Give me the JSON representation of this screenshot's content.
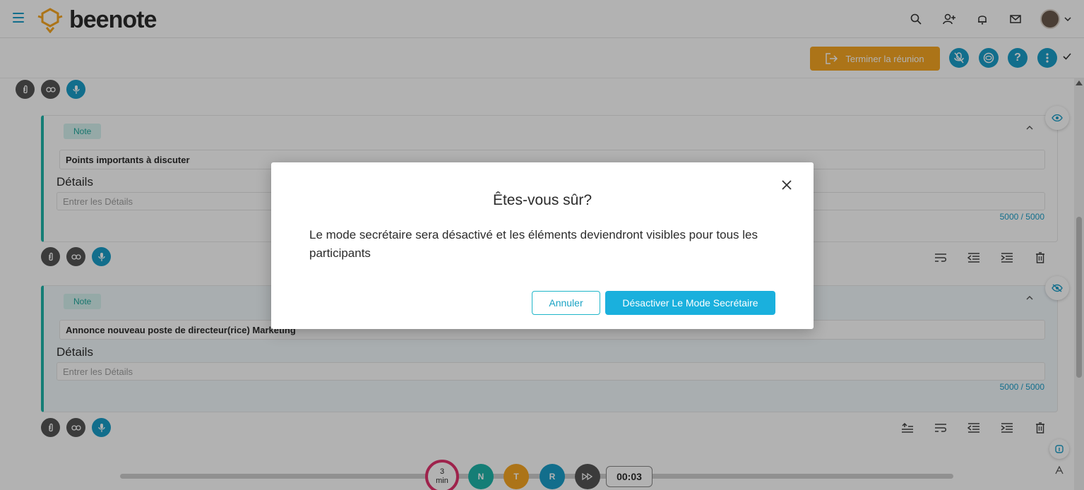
{
  "header": {
    "logo_text": "beenote"
  },
  "meeting_toolbar": {
    "end_meeting_label": "Terminer la réunion",
    "help_label": "?"
  },
  "notes": [
    {
      "badge": "Note",
      "title": "Points importants à discuter",
      "details_label": "Détails",
      "details_placeholder": "Entrer les Détails",
      "counter": "5000 / 5000"
    },
    {
      "badge": "Note",
      "title": "Annonce nouveau poste de directeur(rice) Marketing",
      "details_label": "Détails",
      "details_placeholder": "Entrer les Détails",
      "counter": "5000 / 5000"
    }
  ],
  "bottom": {
    "timer_value": "3",
    "timer_unit": "min",
    "btn_n": "N",
    "btn_t": "T",
    "btn_r": "R",
    "clock": "00:03"
  },
  "modal": {
    "title": "Êtes-vous sûr?",
    "body": "Le mode secrétaire sera désactivé et les éléments deviendront visibles pour tous les participants",
    "cancel_label": "Annuler",
    "confirm_label": "Désactiver Le Mode Secrétaire"
  },
  "colors": {
    "accent": "#1a9ec9",
    "orange": "#f6a623",
    "teal": "#1fb5a9",
    "timer_ring": "#e3336e"
  }
}
